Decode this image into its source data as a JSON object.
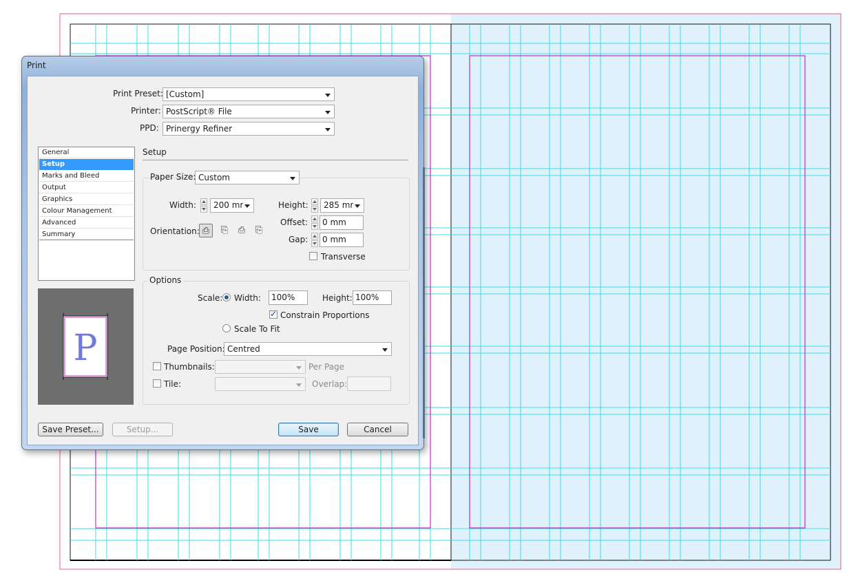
{
  "dialog": {
    "title": "Print",
    "print_preset": {
      "label": "Print Preset:",
      "value": "[Custom]"
    },
    "printer": {
      "label": "Printer:",
      "value": "PostScript® File"
    },
    "ppd": {
      "label": "PPD:",
      "value": "Prinergy Refiner"
    },
    "categories": [
      {
        "label": "General",
        "selected": false
      },
      {
        "label": "Setup",
        "selected": true
      },
      {
        "label": "Marks and Bleed",
        "selected": false
      },
      {
        "label": "Output",
        "selected": false
      },
      {
        "label": "Graphics",
        "selected": false
      },
      {
        "label": "Colour Management",
        "selected": false
      },
      {
        "label": "Advanced",
        "selected": false
      },
      {
        "label": "Summary",
        "selected": false
      }
    ],
    "preview_letter": "P",
    "section_title": "Setup",
    "paper": {
      "size_label": "Paper Size:",
      "size_value": "Custom",
      "width_label": "Width:",
      "width_value": "200 mr",
      "height_label": "Height:",
      "height_value": "285 mr",
      "offset_label": "Offset:",
      "offset_value": "0 mm",
      "gap_label": "Gap:",
      "gap_value": "0 mm",
      "orientation_label": "Orientation:",
      "orientation_icons": [
        "portrait-icon",
        "landscape-icon",
        "reverse-portrait-icon",
        "reverse-landscape-icon"
      ],
      "transverse_label": "Transverse",
      "transverse_checked": false
    },
    "options": {
      "title": "Options",
      "scale_label": "Scale:",
      "width_label": "Width:",
      "width_value": "100%",
      "height_label": "Height:",
      "height_value": "100%",
      "constrain_label": "Constrain Proportions",
      "constrain_checked": true,
      "scale_to_fit_label": "Scale To Fit",
      "page_position_label": "Page Position:",
      "page_position_value": "Centred",
      "thumbnails_label": "Thumbnails:",
      "thumbnails_value": "",
      "per_page_label": "Per Page",
      "tile_label": "Tile:",
      "tile_value": "",
      "overlap_label": "Overlap:",
      "overlap_value": ""
    },
    "buttons": {
      "save_preset": "Save Preset...",
      "setup": "Setup...",
      "save": "Save",
      "cancel": "Cancel"
    }
  },
  "colors": {
    "guide": "#33e0e8",
    "margin": "#c000c0",
    "bleed": "#e06080",
    "pasteboard": "#dff1fa",
    "selection": "#3399ff"
  }
}
